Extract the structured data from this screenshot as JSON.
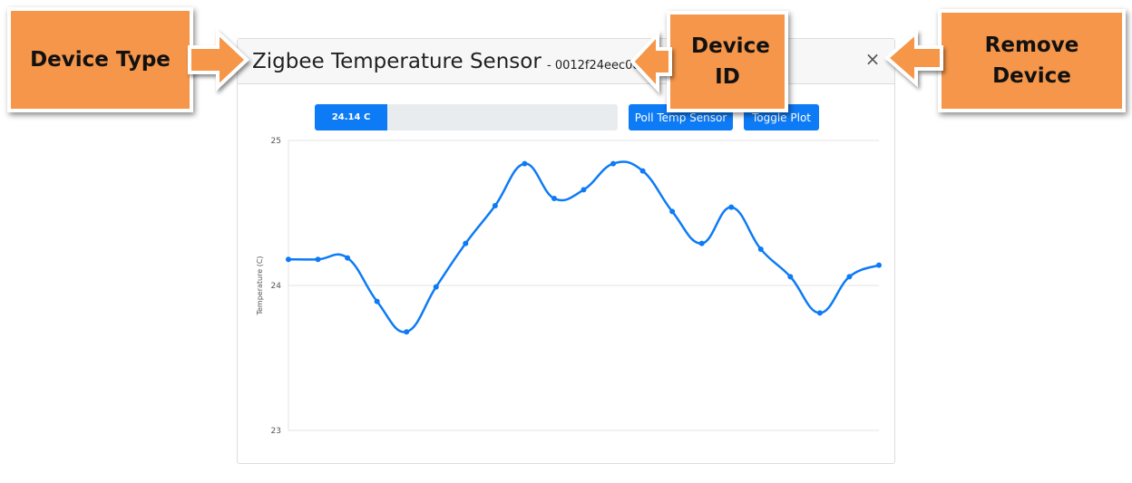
{
  "device": {
    "type": "Zigbee Temperature Sensor",
    "id": "- 0012f24eec08",
    "close_label": "×"
  },
  "reading": {
    "label": "24.14 C",
    "fill_percent": 24
  },
  "buttons": {
    "poll": "Poll Temp Sensor",
    "toggle": "Toggle Plot"
  },
  "annotations": {
    "device_type": "Device Type",
    "device_id": "Device ID",
    "remove_device": "Remove Device"
  },
  "colors": {
    "accent": "#0d7bf5",
    "callout": "#f5964a"
  },
  "chart_data": {
    "type": "line",
    "ylabel": "Temperature (C)",
    "xlabel": "",
    "ylim": [
      23,
      25
    ],
    "yticks": [
      "25",
      "24",
      "23"
    ],
    "grid": true,
    "series": [
      {
        "values": [
          24.18,
          24.18,
          24.19,
          23.89,
          23.68,
          23.99,
          24.29,
          24.55,
          24.84,
          24.6,
          24.66,
          24.84,
          24.79,
          24.51,
          24.29,
          24.54,
          24.25,
          24.06,
          23.81,
          24.06,
          24.14
        ]
      }
    ]
  }
}
